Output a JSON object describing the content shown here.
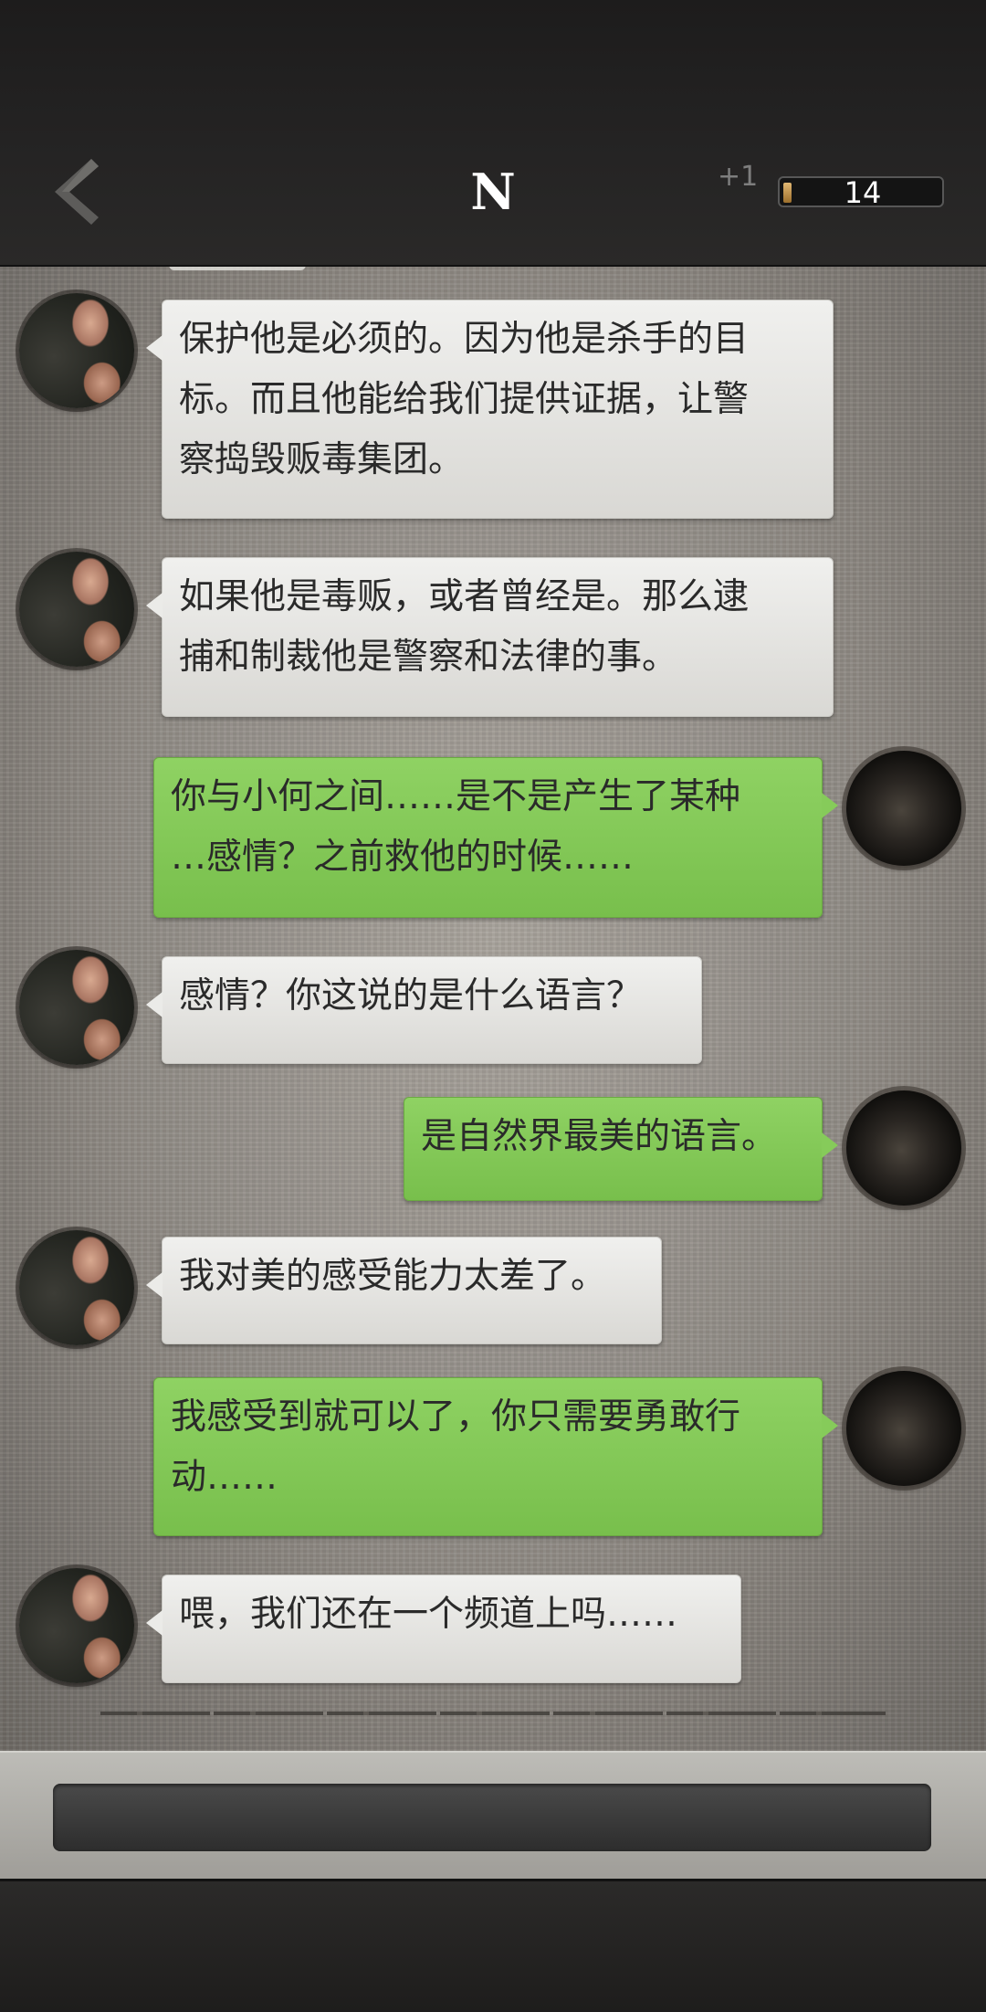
{
  "header": {
    "title": "N",
    "plus_label": "+1",
    "counter_value": "14",
    "counter_fill_fraction": 0.05,
    "back_icon": "chevron-left-icon"
  },
  "messages": [
    {
      "sender": "npc",
      "lines": [
        "保护他是必须的。因为他是杀手的目",
        "标。而且他能给我们提供证据，让警",
        "察捣毁贩毒集团。"
      ]
    },
    {
      "sender": "npc",
      "lines": [
        "如果他是毒贩，或者曾经是。那么逮",
        "捕和制裁他是警察和法律的事。"
      ]
    },
    {
      "sender": "me",
      "lines": [
        "你与小何之间……是不是产生了某种",
        "…感情？之前救他的时候……"
      ]
    },
    {
      "sender": "npc",
      "lines": [
        "感情？你这说的是什么语言？"
      ]
    },
    {
      "sender": "me",
      "lines": [
        "是自然界最美的语言。"
      ]
    },
    {
      "sender": "npc",
      "lines": [
        "我对美的感受能力太差了。"
      ]
    },
    {
      "sender": "me",
      "lines": [
        "我感受到就可以了，你只需要勇敢行",
        "动……"
      ]
    },
    {
      "sender": "npc",
      "lines": [
        "喂，我们还在一个频道上吗……"
      ]
    }
  ],
  "colors": {
    "my_bubble": "#86cb5a",
    "npc_bubble": "#e9e9e6",
    "topbar": "#242323"
  }
}
